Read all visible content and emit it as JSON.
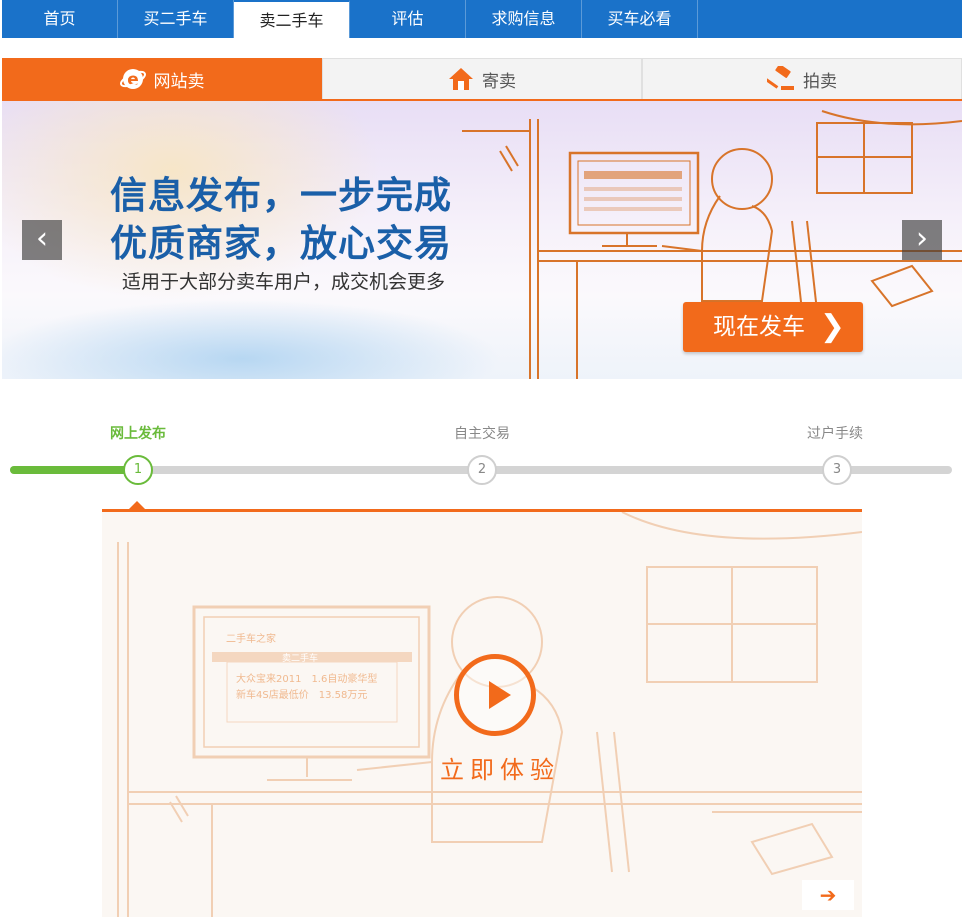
{
  "nav": {
    "items": [
      {
        "label": "首页"
      },
      {
        "label": "买二手车"
      },
      {
        "label": "卖二手车"
      },
      {
        "label": "评估"
      },
      {
        "label": "求购信息"
      },
      {
        "label": "买车必看"
      }
    ],
    "active_index": 2
  },
  "sell_tabs": [
    {
      "label": "网站卖",
      "icon": "ie-icon"
    },
    {
      "label": "寄卖",
      "icon": "house-icon"
    },
    {
      "label": "拍卖",
      "icon": "gavel-icon"
    }
  ],
  "banner": {
    "headline1": "信息发布，一步完成",
    "headline2": "优质商家，放心交易",
    "subtitle": "适用于大部分卖车用户，成交机会更多",
    "cta_label": "现在发车",
    "prev_symbol": "‹",
    "next_symbol": "›"
  },
  "steps": {
    "items": [
      {
        "label": "网上发布",
        "num": "1"
      },
      {
        "label": "自主交易",
        "num": "2"
      },
      {
        "label": "过户手续",
        "num": "3"
      }
    ],
    "current": 1
  },
  "video": {
    "play_label": "立即体验",
    "screen_title": "二手车之家",
    "screen_tab": "卖二手车",
    "screen_line1": "大众宝来2011　1.6自动豪华型",
    "screen_line2": "新车4S店最低价　13.58万元",
    "next_symbol": "➔"
  },
  "colors": {
    "nav_blue": "#1a72c9",
    "accent_orange": "#f26a1b",
    "step_green": "#6abb3b",
    "headline_blue": "#1a5fa8"
  }
}
